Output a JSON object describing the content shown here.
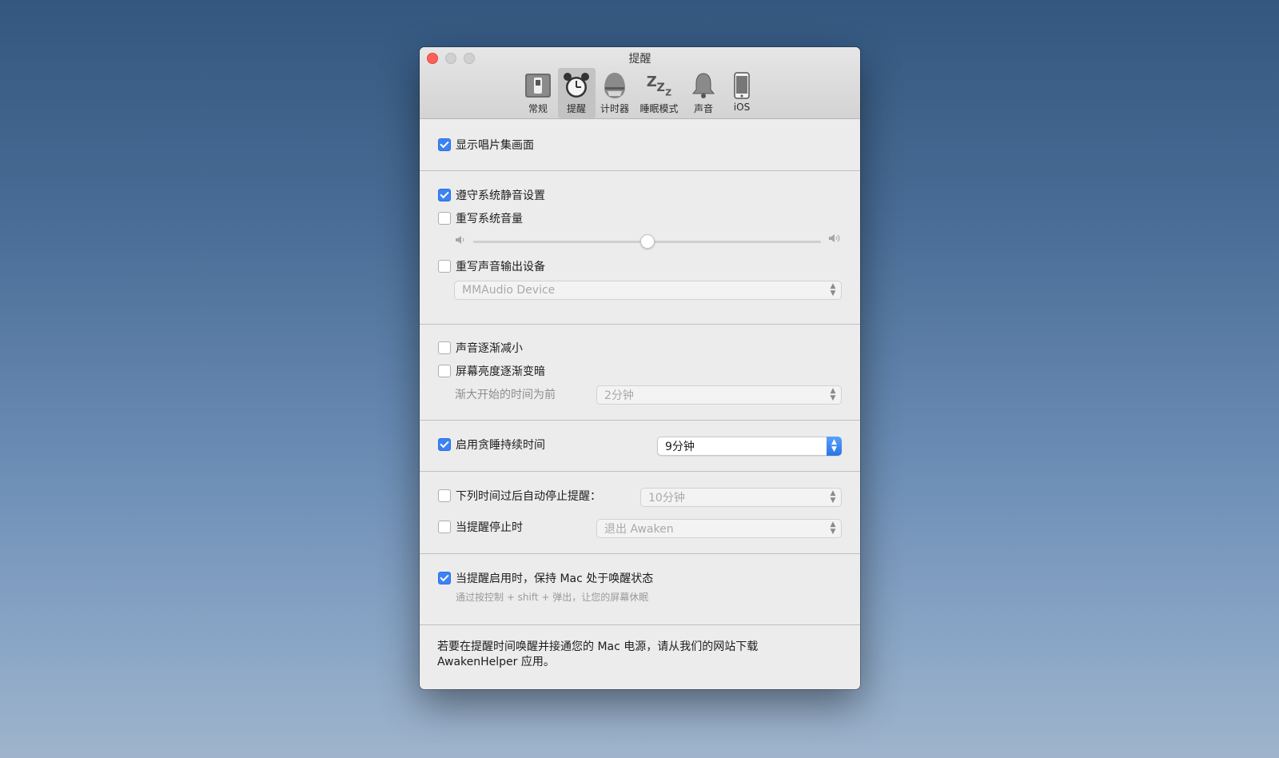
{
  "window": {
    "title": "提醒"
  },
  "toolbar": {
    "items": [
      {
        "label": "常规",
        "icon": "switch-icon"
      },
      {
        "label": "提醒",
        "icon": "alarm-clock-icon",
        "active": true
      },
      {
        "label": "计时器",
        "icon": "egg-timer-icon"
      },
      {
        "label": "睡眠模式",
        "icon": "zzz-icon"
      },
      {
        "label": "声音",
        "icon": "bell-icon"
      },
      {
        "label": "iOS",
        "icon": "iphone-icon"
      }
    ]
  },
  "settings": {
    "show_album_art": {
      "label": "显示唱片集画面",
      "checked": true
    },
    "respect_mute": {
      "label": "遵守系统静音设置",
      "checked": true
    },
    "override_volume": {
      "label": "重写系统音量",
      "checked": false
    },
    "volume_slider": {
      "value_percent": 50
    },
    "override_output": {
      "label": "重写声音输出设备",
      "checked": false
    },
    "output_device": {
      "value": "MMAudio Device"
    },
    "fade_sound": {
      "label": "声音逐渐减小",
      "checked": false
    },
    "dim_screen": {
      "label": "屏幕亮度逐渐变暗",
      "checked": false
    },
    "fade_start": {
      "label": "渐大开始的时间为前",
      "value": "2分钟"
    },
    "snooze": {
      "label": "启用贪睡持续时间",
      "checked": true,
      "value": "9分钟"
    },
    "auto_stop": {
      "label": "下列时间过后自动停止提醒：",
      "checked": false,
      "value": "10分钟"
    },
    "on_stop": {
      "label": "当提醒停止时",
      "checked": false,
      "value": "退出 Awaken"
    },
    "keep_awake": {
      "label": "当提醒启用时，保持 Mac 处于唤醒状态",
      "checked": true,
      "hint": "通过按控制 + shift + 弹出，让您的屏幕休眠"
    }
  },
  "footer": {
    "text": "若要在提醒时间唤醒并接通您的 Mac 电源，请从我们的网站下载 AwakenHelper 应用。"
  },
  "colors": {
    "accent": "#3b82f6",
    "close": "#fe5f57"
  }
}
